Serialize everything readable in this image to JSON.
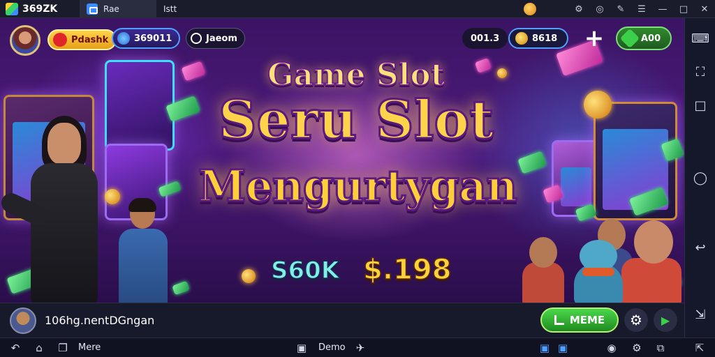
{
  "titlebar": {
    "app_name": "369ZK",
    "tabs": [
      {
        "label": "Rae",
        "icon": "home-icon"
      },
      {
        "label": "Istt",
        "icon": "game-icon"
      }
    ],
    "icons": [
      "coin-icon",
      "account-icon",
      "help-icon",
      "settings-icon",
      "minimize-icon",
      "maximize-icon",
      "close-icon"
    ]
  },
  "hud": {
    "pill_red": "Pdashk",
    "pill_blue": "369011",
    "pill_dark": "Jaeom",
    "pill_num": "001.3",
    "pill_coin": "8618",
    "pill_green": "A00"
  },
  "banner": {
    "line1": "Game Slot",
    "line2": "Seru Slot",
    "line3": "Mengurtygan",
    "prize_a": "S60K",
    "prize_b": "$.198"
  },
  "bottombar": {
    "title": "106hg.nentDGngan",
    "play_label": "MEME"
  },
  "statusbar": {
    "more_label": "Mere",
    "center_label": "Demo"
  },
  "colors": {
    "background": "#3b1463",
    "title_gold": "#ffd34a",
    "accent_green": "#3cd04a",
    "accent_blue": "#4fa0ff"
  }
}
